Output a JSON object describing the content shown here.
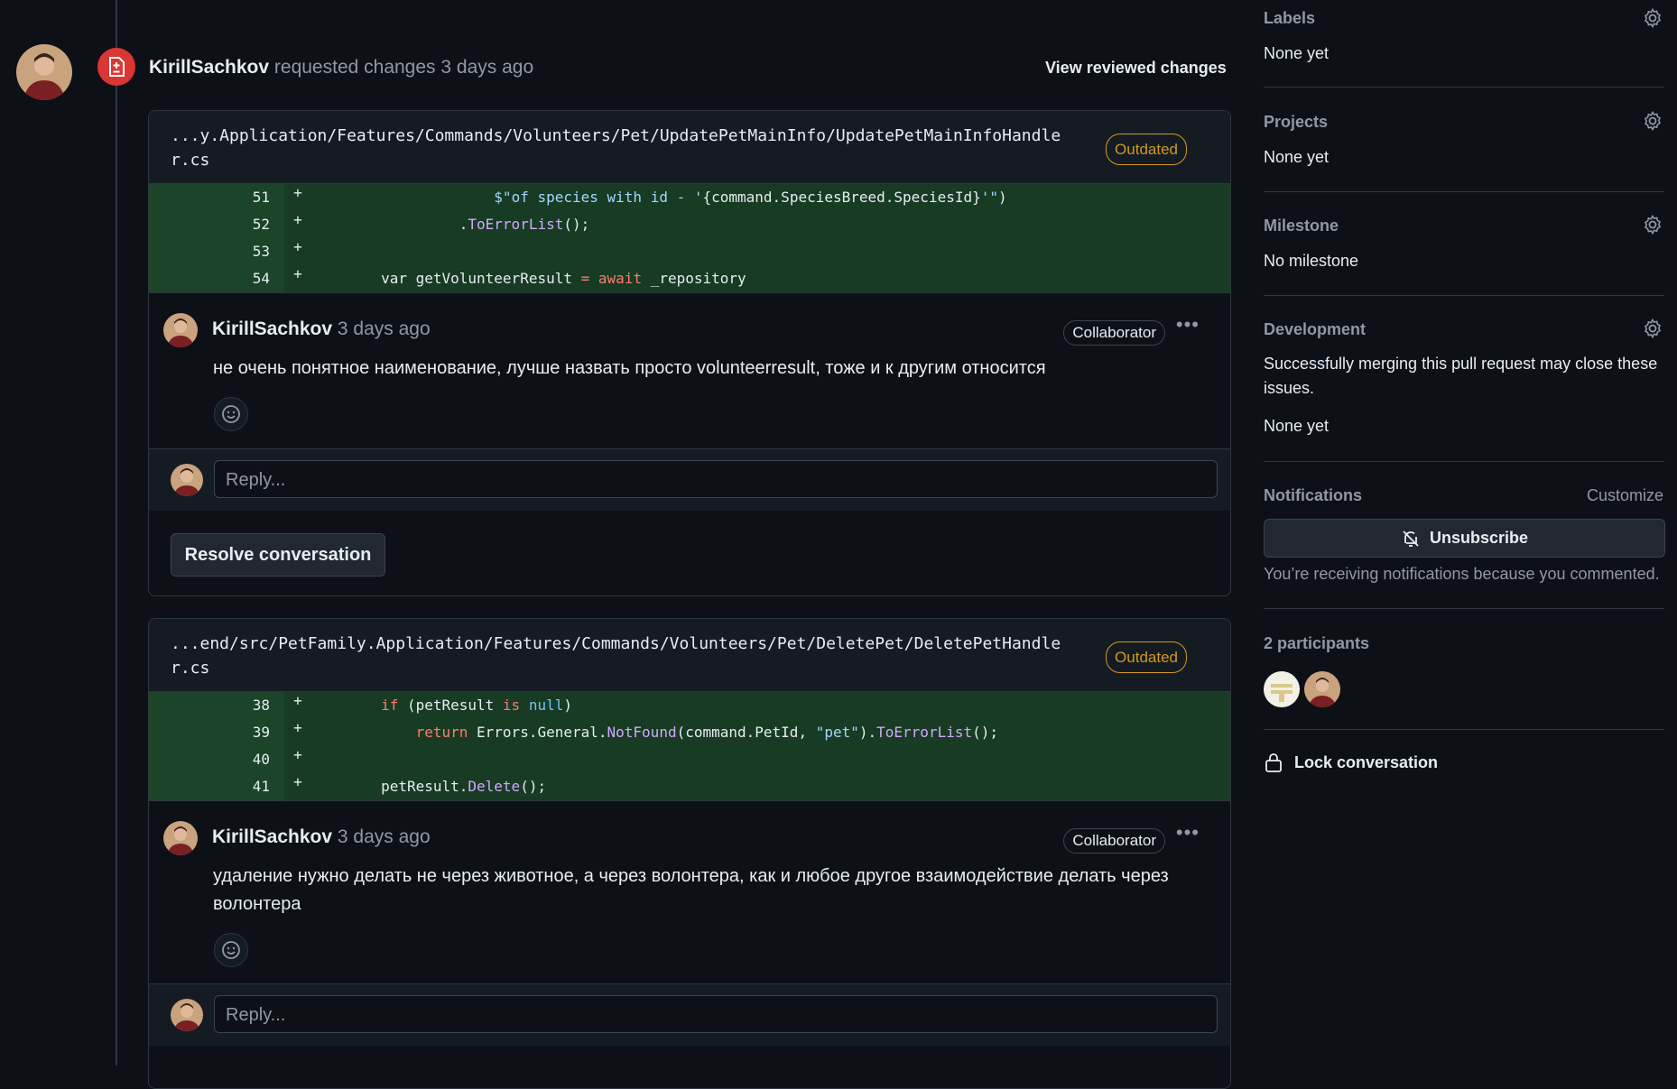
{
  "review": {
    "author": "KirillSachkov",
    "action": "requested changes",
    "time": "3 days ago",
    "view_changes_label": "View reviewed changes"
  },
  "threads": [
    {
      "file_path_line1": "...y.Application/Features/Commands/Volunteers/Pet/UpdatePetMainInfo/UpdatePetMainInfoHandle",
      "file_path_line2": "r.cs",
      "badge": "Outdated",
      "diff": [
        {
          "num": "51",
          "sign": "+"
        },
        {
          "num": "52",
          "sign": "+"
        },
        {
          "num": "53",
          "sign": "+"
        },
        {
          "num": "54",
          "sign": "+"
        }
      ],
      "comment": {
        "author": "KirillSachkov",
        "time": "3 days ago",
        "badge": "Collaborator",
        "body": "не очень понятное наименование, лучше назвать просто volunteerresult, тоже и к другим относится"
      },
      "reply_placeholder": "Reply...",
      "resolve_label": "Resolve conversation"
    },
    {
      "file_path_line1": "...end/src/PetFamily.Application/Features/Commands/Volunteers/Pet/DeletePet/DeletePetHandle",
      "file_path_line2": "r.cs",
      "badge": "Outdated",
      "diff": [
        {
          "num": "38",
          "sign": "+"
        },
        {
          "num": "39",
          "sign": "+"
        },
        {
          "num": "40",
          "sign": "+"
        },
        {
          "num": "41",
          "sign": "+"
        }
      ],
      "comment": {
        "author": "KirillSachkov",
        "time": "3 days ago",
        "badge": "Collaborator",
        "body": "удаление нужно делать не через животное, а через волонтера, как и любое другое взаимодействие делать через волонтера"
      },
      "reply_placeholder": "Reply..."
    }
  ],
  "sidebar": {
    "labels": {
      "title": "Labels",
      "value": "None yet"
    },
    "projects": {
      "title": "Projects",
      "value": "None yet"
    },
    "milestone": {
      "title": "Milestone",
      "value": "No milestone"
    },
    "development": {
      "title": "Development",
      "description": "Successfully merging this pull request may close these issues.",
      "value": "None yet"
    },
    "notifications": {
      "title": "Notifications",
      "customize": "Customize",
      "button": "Unsubscribe",
      "note": "You’re receiving notifications because you commented."
    },
    "participants": {
      "title": "2 participants"
    },
    "lock": "Lock conversation"
  },
  "colors": {
    "background": "#0d1117",
    "changes_requested": "#da3633",
    "outdated": "#d29922",
    "diff_added": "#173b23"
  }
}
